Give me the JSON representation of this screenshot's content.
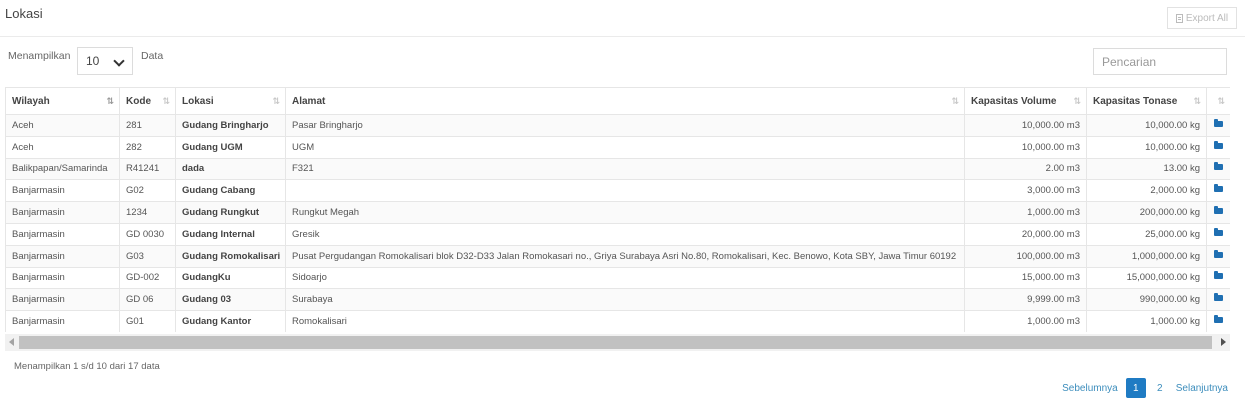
{
  "header": {
    "title": "Lokasi",
    "export_label": "Export All"
  },
  "length": {
    "prefix": "Menampilkan",
    "value": "10",
    "suffix": "Data"
  },
  "search": {
    "placeholder": "Pencarian"
  },
  "table": {
    "columns": [
      "Wilayah",
      "Kode",
      "Lokasi",
      "Alamat",
      "Kapasitas Volume",
      "Kapasitas Tonase",
      ""
    ],
    "rows": [
      [
        "Aceh",
        "281",
        "Gudang Bringharjo",
        "Pasar Bringharjo",
        "10,000.00 m3",
        "10,000.00 kg"
      ],
      [
        "Aceh",
        "282",
        "Gudang UGM",
        "UGM",
        "10,000.00 m3",
        "10,000.00 kg"
      ],
      [
        "Balikpapan/Samarinda",
        "R41241",
        "dada",
        "F321",
        "2.00 m3",
        "13.00 kg"
      ],
      [
        "Banjarmasin",
        "G02",
        "Gudang Cabang",
        "",
        "3,000.00 m3",
        "2,000.00 kg"
      ],
      [
        "Banjarmasin",
        "1234",
        "Gudang Rungkut",
        "Rungkut Megah",
        "1,000.00 m3",
        "200,000.00 kg"
      ],
      [
        "Banjarmasin",
        "GD 0030",
        "Gudang Internal",
        "Gresik",
        "20,000.00 m3",
        "25,000.00 kg"
      ],
      [
        "Banjarmasin",
        "G03",
        "Gudang Romokalisari",
        "Pusat Pergudangan Romokalisari blok D32-D33 Jalan Romokasari no., Griya Surabaya Asri No.80, Romokalisari, Kec. Benowo, Kota SBY, Jawa Timur 60192",
        "100,000.00 m3",
        "1,000,000.00 kg"
      ],
      [
        "Banjarmasin",
        "GD-002",
        "GudangKu",
        "Sidoarjo",
        "15,000.00 m3",
        "15,000,000.00 kg"
      ],
      [
        "Banjarmasin",
        "GD 06",
        "Gudang 03",
        "Surabaya",
        "9,999.00 m3",
        "990,000.00 kg"
      ],
      [
        "Banjarmasin",
        "G01",
        "Gudang Kantor",
        "Romokalisari",
        "1,000.00 m3",
        "1,000.00 kg"
      ]
    ]
  },
  "footer": {
    "info": "Menampilkan 1 s/d 10 dari 17 data",
    "prev": "Sebelumnya",
    "pages": [
      "1",
      "2"
    ],
    "next": "Selanjutnya"
  },
  "colors": {
    "accent": "#1f7bc3",
    "link": "#3c8dbc",
    "folder_icon": "#1f6fb2"
  }
}
